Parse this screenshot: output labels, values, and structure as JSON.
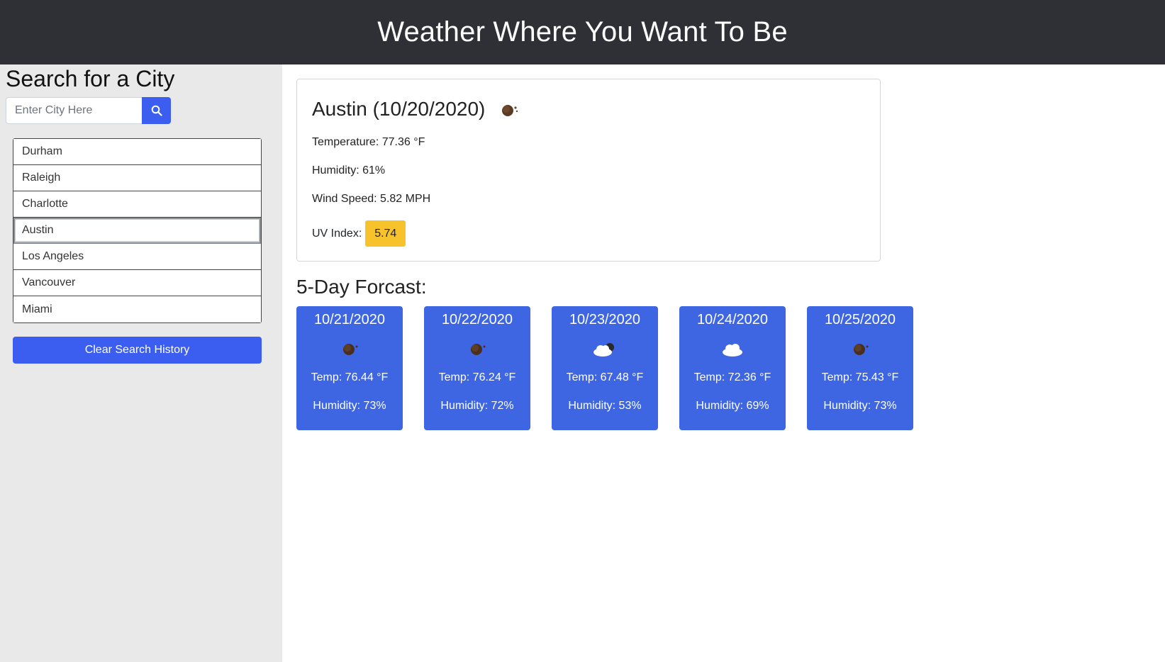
{
  "header": {
    "title": "Weather Where You Want To Be"
  },
  "sidebar": {
    "heading": "Search for a City",
    "search": {
      "placeholder": "Enter City Here",
      "value": ""
    },
    "history": [
      "Durham",
      "Raleigh",
      "Charlotte",
      "Austin",
      "Los Angeles",
      "Vancouver",
      "Miami"
    ],
    "active_city": "Austin",
    "clear_label": "Clear Search History"
  },
  "current": {
    "title": "Austin (10/20/2020)",
    "icon": "clear-night-icon",
    "temperature": "Temperature: 77.36 °F",
    "humidity": "Humidity: 61%",
    "wind": "Wind Speed: 5.82 MPH",
    "uv_label": "UV Index:",
    "uv_value": "5.74",
    "uv_color": "#f6c32c"
  },
  "forecast": {
    "title": "5-Day Forcast:",
    "card_color": "#3f66e2",
    "days": [
      {
        "date": "10/21/2020",
        "icon": "clear-night-icon",
        "temp": "Temp: 76.44 °F",
        "humidity": "Humidity: 73%"
      },
      {
        "date": "10/22/2020",
        "icon": "clear-night-icon",
        "temp": "Temp: 76.24 °F",
        "humidity": "Humidity: 72%"
      },
      {
        "date": "10/23/2020",
        "icon": "partly-cloudy-night-icon",
        "temp": "Temp: 67.48 °F",
        "humidity": "Humidity: 53%"
      },
      {
        "date": "10/24/2020",
        "icon": "cloud-icon",
        "temp": "Temp: 72.36 °F",
        "humidity": "Humidity: 69%"
      },
      {
        "date": "10/25/2020",
        "icon": "clear-night-icon",
        "temp": "Temp: 75.43 °F",
        "humidity": "Humidity: 73%"
      }
    ]
  }
}
